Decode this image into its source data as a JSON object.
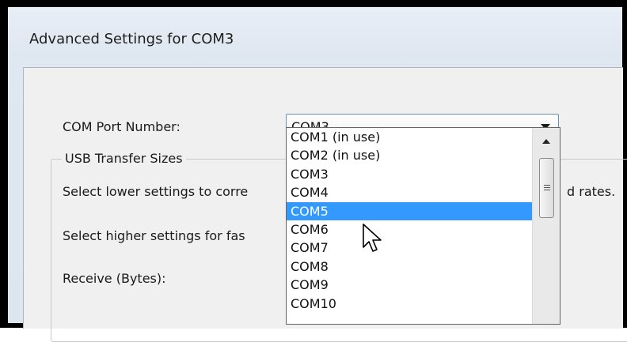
{
  "window": {
    "title": "Advanced Settings for COM3"
  },
  "form": {
    "com_port_label": "COM Port Number:",
    "usb_group_title": "USB Transfer Sizes",
    "lower_settings_text": "Select lower settings to corre",
    "lower_settings_tail": "d rates.",
    "higher_settings_text": "Select higher settings for fas",
    "receive_label": "Receive (Bytes):"
  },
  "combo": {
    "selected": "COM3",
    "options": [
      "COM1 (in use)",
      "COM2 (in use)",
      "COM3",
      "COM4",
      "COM5",
      "COM6",
      "COM7",
      "COM8",
      "COM9",
      "COM10"
    ],
    "highlighted": "COM5"
  },
  "colors": {
    "highlight": "#3399ff",
    "dialog_bg": "#f0f0f0"
  },
  "icons": {
    "dropdown": "chevron-down-icon",
    "scroll_up": "arrow-up-icon",
    "cursor": "pointer-cursor-icon"
  }
}
